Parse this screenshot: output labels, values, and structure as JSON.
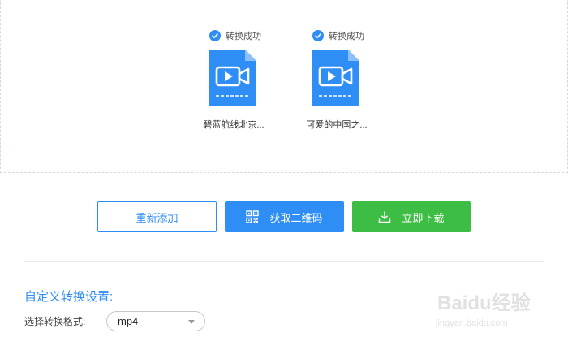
{
  "files": [
    {
      "status": "转换成功",
      "name": "碧蓝航线北京...",
      "icon": "video-file-icon"
    },
    {
      "status": "转换成功",
      "name": "可爱的中国之...",
      "icon": "video-file-icon"
    }
  ],
  "actions": {
    "readd_label": "重新添加",
    "qr_label": "获取二维码",
    "download_label": "立即下载"
  },
  "settings": {
    "title": "自定义转换设置:",
    "format_label": "选择转换格式:",
    "format_value": "mp4"
  },
  "watermark": {
    "brand": "Baidu经验",
    "url": "jingyan.baidu.com"
  },
  "colors": {
    "accent": "#2f8ef6",
    "success": "#3ebd45"
  }
}
